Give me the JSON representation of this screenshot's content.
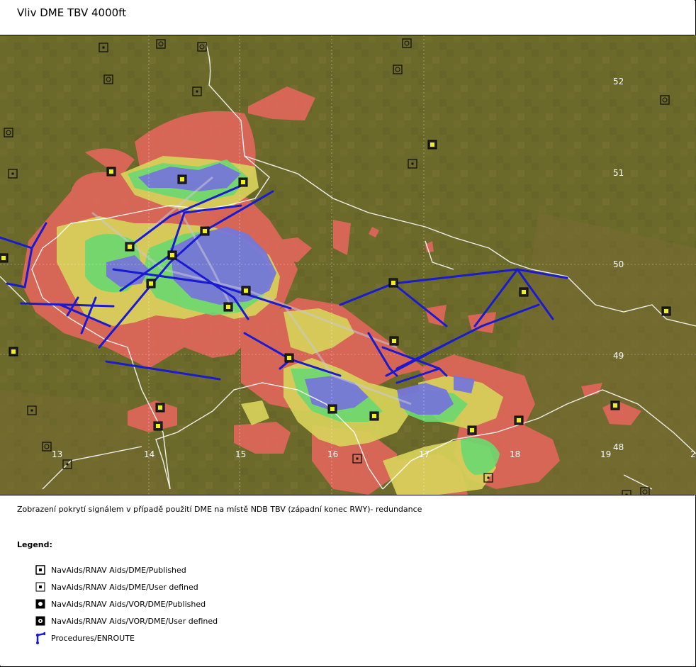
{
  "title": "Vliv DME TBV 4000ft",
  "caption": "Zobrazení pokrytí signálem v případě použití DME na místě NDB TBV (západní konec RWY)- redundance",
  "map": {
    "longitude_labels": [
      "13",
      "14",
      "15",
      "16",
      "17",
      "18",
      "19",
      "2"
    ],
    "latitude_labels": [
      "52",
      "51",
      "50",
      "49",
      "48"
    ],
    "colors": {
      "terrain": "#6b6a2a",
      "coverage_red": "#e0665a",
      "coverage_yellow": "#d8d25a",
      "coverage_green": "#6dd870",
      "coverage_blue": "#7777d8",
      "route": "#1a1ad0",
      "border": "#ffffff",
      "navaid_published": "#f0f020"
    }
  },
  "legend": {
    "title": "Legend:",
    "items": [
      {
        "label": "NavAids/RNAV Aids/DME/Published",
        "icon": "dme-published-icon"
      },
      {
        "label": "NavAids/RNAV Aids/DME/User defined",
        "icon": "dme-user-defined-icon"
      },
      {
        "label": "NavAids/RNAV Aids/VOR/DME/Published",
        "icon": "vor-dme-published-icon"
      },
      {
        "label": "NavAids/RNAV Aids/VOR/DME/User defined",
        "icon": "vor-dme-user-defined-icon"
      },
      {
        "label": "Procedures/ENROUTE",
        "icon": "enroute-procedure-icon"
      }
    ]
  }
}
